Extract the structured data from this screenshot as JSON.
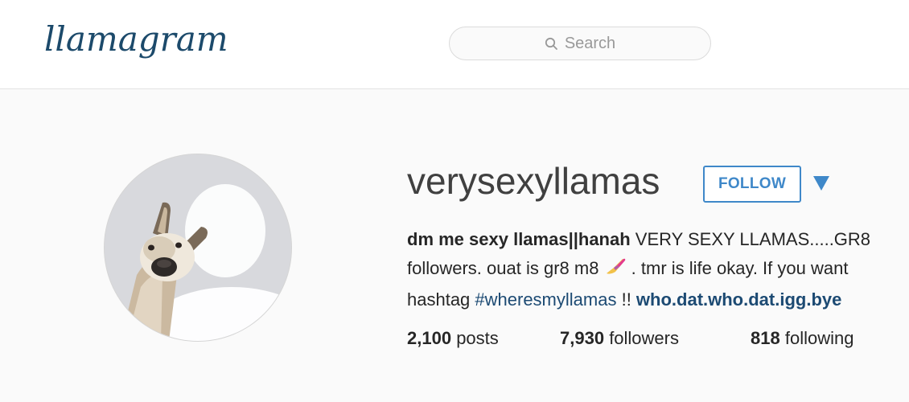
{
  "header": {
    "logo_text": "llamagram",
    "search_placeholder": "Search",
    "search_icon": "search-icon"
  },
  "profile": {
    "username": "verysexyllamas",
    "follow_label": "FOLLOW",
    "dropdown_icon": "caret-down-icon",
    "accent_color": "#3f88c9",
    "bio": {
      "line1_bold": "dm me sexy llamas||hanah",
      "line1_rest": " VERY SEXY LLAMAS.....GR8",
      "line2_part1": "followers. ouat is gr8 m8 ",
      "line2_emoji": "nail-polish-emoji",
      "line2_part2": " . tmr is life okay. If you want",
      "line3_part1": "hashtag ",
      "line3_hashtag": "#wheresmyllamas",
      "line3_part2": " !! ",
      "line3_link": "who.dat.who.dat.igg.bye"
    },
    "stats": {
      "posts_count": "2,100",
      "posts_label": "posts",
      "followers_count": "7,930",
      "followers_label": "followers",
      "following_count": "818",
      "following_label": "following"
    }
  }
}
